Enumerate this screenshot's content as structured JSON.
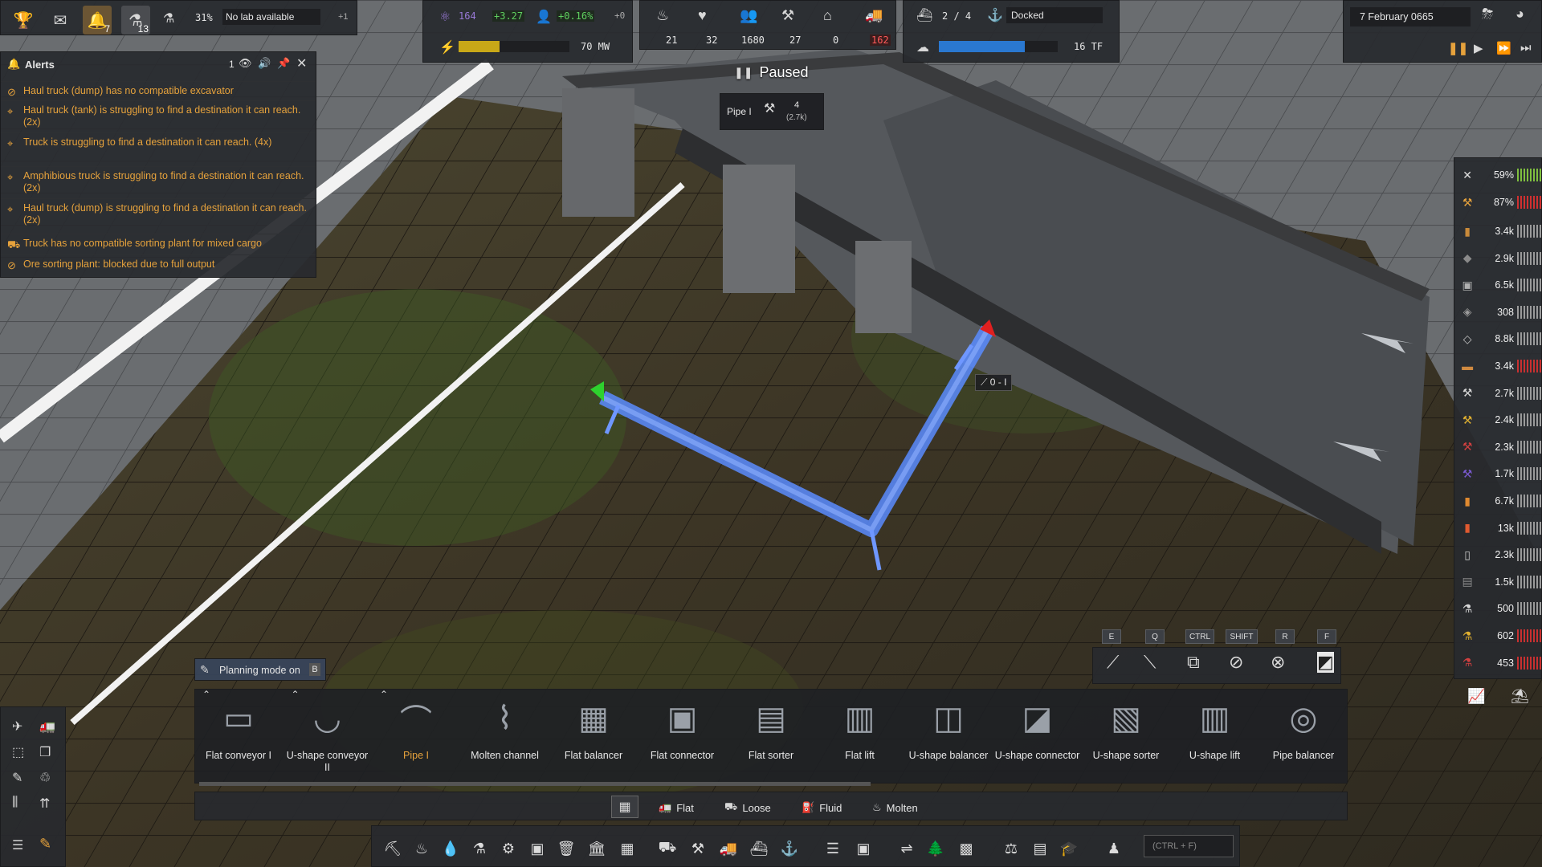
{
  "top_left": {
    "notifications_count": "7",
    "research_count": "13",
    "research_percent": "31%",
    "lab_status": "No lab available",
    "lab_extra": "+1"
  },
  "unity": {
    "value": "164",
    "delta": "+3.27",
    "pop_delta": "+0.16%",
    "pop_extra": "+0"
  },
  "power": {
    "value": "70 MW",
    "fill_fraction": 0.37
  },
  "stats": {
    "food": "21",
    "health": "32",
    "population": "1680",
    "workers": "27",
    "housing": "0",
    "vehicles": "162"
  },
  "ships": {
    "count": "2 / 4",
    "status": "Docked"
  },
  "computing": {
    "value": "16 TF",
    "fill_fraction": 0.72
  },
  "date": "7 February 0665",
  "paused_label": "Paused",
  "tooltip": {
    "name": "Pipe I",
    "count": "4",
    "sub": "(2.7k)"
  },
  "pipe_label": "0 - I",
  "alerts": {
    "title": "Alerts",
    "count": "1",
    "items": [
      "Haul truck (dump) has no compatible excavator",
      "Haul truck (tank) is struggling to find a destination it can reach. (2x)",
      "Truck is struggling to find a destination it can reach. (4x)",
      "Amphibious truck is struggling to find a destination it can reach. (2x)",
      "Haul truck (dump) is struggling to find a destination it can reach. (2x)",
      "Truck has no compatible sorting plant for mixed cargo",
      "Ore sorting plant: blocked due to full output"
    ]
  },
  "maintenance": [
    {
      "value": "59%",
      "color": "#7fbf3f"
    },
    {
      "value": "87%",
      "color": "#d03030"
    }
  ],
  "stocks": [
    {
      "value": "3.4k",
      "color": "#c98a3a"
    },
    {
      "value": "2.9k",
      "color": "#8a8a8a"
    },
    {
      "value": "6.5k",
      "color": "#b0b0b0"
    },
    {
      "value": "308",
      "color": "#9a9a9a"
    },
    {
      "value": "8.8k",
      "color": "#c0c0c0"
    },
    {
      "value": "3.4k",
      "color": "#d08a40"
    },
    {
      "value": "2.7k",
      "color": "#d8d8d8"
    },
    {
      "value": "2.4k",
      "color": "#e0b030"
    },
    {
      "value": "2.3k",
      "color": "#d04040"
    },
    {
      "value": "1.7k",
      "color": "#7a5ad0"
    },
    {
      "value": "6.7k",
      "color": "#e08a30"
    },
    {
      "value": "13k",
      "color": "#e05a30"
    },
    {
      "value": "2.3k",
      "color": "#c8c8c8"
    },
    {
      "value": "1.5k",
      "color": "#8a8a8a"
    },
    {
      "value": "500",
      "color": "#d8d8d8"
    },
    {
      "value": "602",
      "color": "#e0b030"
    },
    {
      "value": "453",
      "color": "#d04040"
    }
  ],
  "keycaps": [
    "E",
    "Q",
    "CTRL",
    "SHIFT",
    "R",
    "F"
  ],
  "planning": {
    "label": "Planning mode on",
    "key": "B"
  },
  "tools": [
    "Flat conveyor I",
    "U-shape conveyor II",
    "Pipe I",
    "Molten channel",
    "Flat balancer",
    "Flat connector",
    "Flat sorter",
    "Flat lift",
    "U-shape balancer",
    "U-shape connector",
    "U-shape sorter",
    "U-shape lift",
    "Pipe balancer"
  ],
  "modes": [
    "Flat",
    "Loose",
    "Fluid",
    "Molten"
  ],
  "search_placeholder": "(CTRL + F)",
  "colors": {
    "accent": "#e6a23c",
    "pipe": "#5b8cff",
    "selected": "#e6a23c"
  }
}
